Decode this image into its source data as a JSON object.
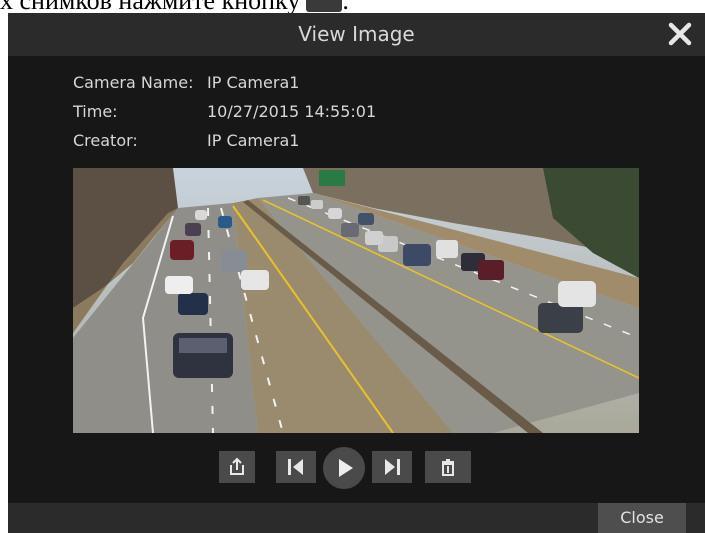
{
  "doc_text": "х снимков нажмите кнопку",
  "dialog": {
    "title": "View Image",
    "close_button_label": "Close"
  },
  "info": [
    {
      "label": "Camera Name:",
      "value": "IP Camera1"
    },
    {
      "label": "Time:",
      "value": "10/27/2015 14:55:01"
    },
    {
      "label": "Creator:",
      "value": "IP Camera1"
    }
  ],
  "colors": {
    "dialog_bg": "#171717",
    "titlebar_bg": "#2b2b2b",
    "button_bg": "#4a4a4a",
    "text": "#d6d6d6"
  },
  "icons": {
    "close": "close-icon",
    "export": "export-icon",
    "previous": "previous-icon",
    "play": "play-icon",
    "next": "next-icon",
    "delete": "trash-icon"
  }
}
